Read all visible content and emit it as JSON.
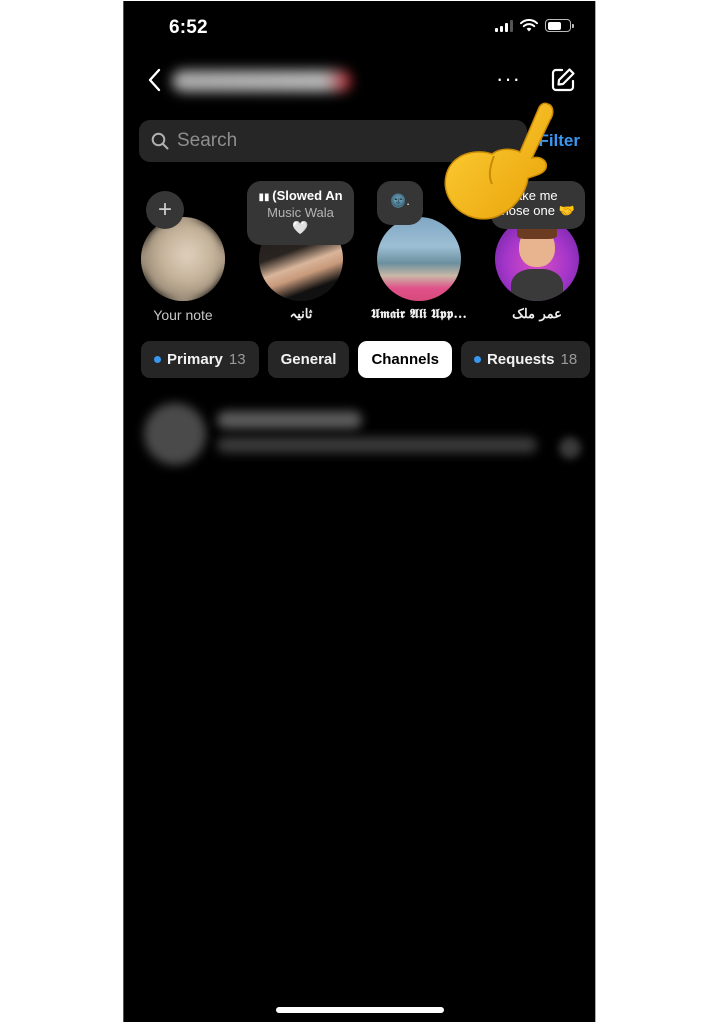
{
  "status_bar": {
    "time": "6:52",
    "icons": [
      "cellular-signal-icon",
      "wifi-icon",
      "battery-icon"
    ]
  },
  "header": {
    "back_icon": "chevron-left-icon",
    "account_name": "(blurred username)",
    "more_icon": "more-horizontal-icon",
    "more_label": "···",
    "compose_icon": "compose-edit-icon"
  },
  "search": {
    "placeholder": "Search",
    "value": "",
    "icon": "search-icon",
    "filter_label": "Filter"
  },
  "notes": [
    {
      "label": "Your note",
      "add_icon": "plus-icon",
      "add_label": "+"
    },
    {
      "label": "ثانیہ",
      "bubble_icon": "audio-bars-icon",
      "bubble_line1": "(Slowed An",
      "bubble_line2": "Music Wala",
      "bubble_line3": "🤍"
    },
    {
      "label": "𝖀𝖒𝖆𝖎𝖗 𝕬𝖑𝖎 𝖀𝖕𝖕...",
      "bubble_line1": "🌚."
    },
    {
      "label": "عمر ملک",
      "bubble_line1": "ake me",
      "bubble_line2": "chose one 🤝"
    }
  ],
  "tabs": [
    {
      "label": "Primary",
      "count": "13",
      "dot": true,
      "active": false
    },
    {
      "label": "General",
      "count": "",
      "dot": false,
      "active": false
    },
    {
      "label": "Channels",
      "count": "",
      "dot": false,
      "active": true
    },
    {
      "label": "Requests",
      "count": "18",
      "dot": true,
      "active": false
    }
  ],
  "threads": [
    {
      "title": "(blurred name)",
      "preview": "(blurred message preview)"
    }
  ],
  "overlay": {
    "pointer_icon": "pointing-hand-emoji-icon",
    "target": "compose-button"
  },
  "colors": {
    "accent": "#3897f0",
    "background": "#000000",
    "surface": "#262626",
    "bubble": "#363636",
    "pointer": "#f5b50f"
  }
}
